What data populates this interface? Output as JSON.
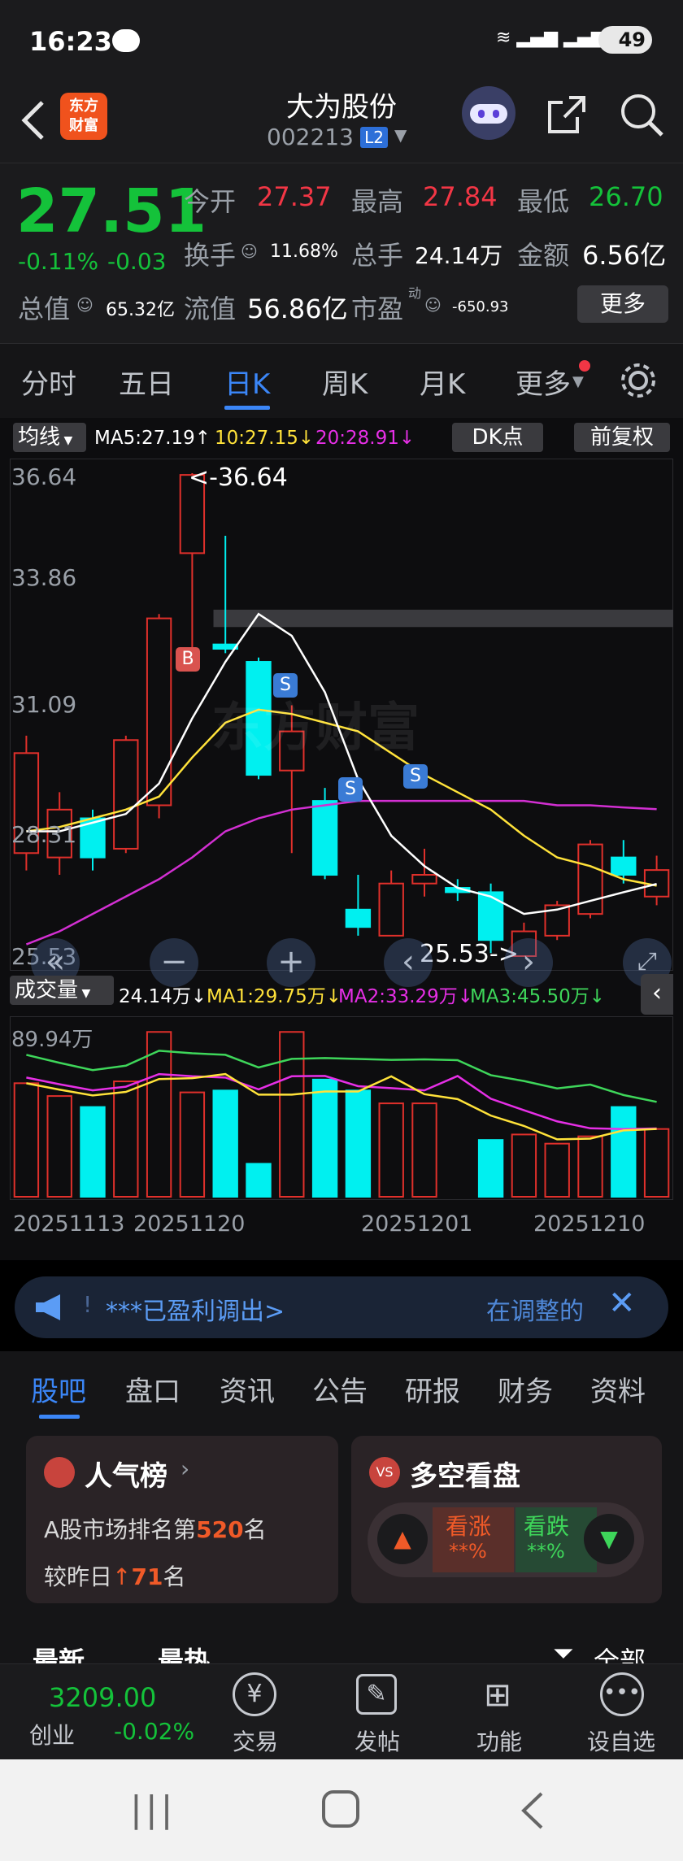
{
  "status": {
    "time": "16:23",
    "battery": "49"
  },
  "header": {
    "logo": "东方\n财富",
    "name": "大为股份",
    "code": "002213",
    "level": "L2"
  },
  "quote": {
    "price": "27.51",
    "change_pct": "-0.11%",
    "change": "-0.03",
    "open_label": "今开",
    "open": "27.37",
    "high_label": "最高",
    "high": "27.84",
    "low_label": "最低",
    "low": "26.70",
    "turnover_label": "换手",
    "turnover": "11.68%",
    "volume_label": "总手",
    "volume": "24.14万",
    "amount_label": "金额",
    "amount": "6.56亿",
    "mcap_label": "总值",
    "mcap": "65.32亿",
    "float_label": "流值",
    "float": "56.86亿",
    "pe_label": "市盈",
    "pe_sup": "动",
    "pe": "-650.93",
    "more": "更多"
  },
  "tabs": [
    "分时",
    "五日",
    "日K",
    "周K",
    "月K",
    "更多"
  ],
  "chart": {
    "ma_toggle": "均线",
    "ma5": "MA5:27.19↑",
    "ma10": "10:27.15↓",
    "ma20": "20:28.91↓",
    "dk": "DK点",
    "adjust": "前复权",
    "yticks": [
      "36.64",
      "33.86",
      "31.09",
      "28.31",
      "25.53"
    ],
    "high_mark": "<-36.64",
    "low_mark": "25.53->",
    "b_mark": "B",
    "s_mark": "S",
    "watermark": "东方财富",
    "vol_toggle": "成交量",
    "vol": "24.14万↓",
    "vma1": "MA1:29.75万↓",
    "vma2": "MA2:33.29万↓",
    "vma3": "MA3:45.50万↓",
    "vol_max": "89.94万",
    "dates": [
      "20251113",
      "20251120",
      "20251201",
      "20251210"
    ]
  },
  "chart_data": {
    "type": "candlestick",
    "candles": [
      {
        "o": 27.9,
        "c": 30.2,
        "h": 30.6,
        "l": 27.5
      },
      {
        "o": 27.8,
        "c": 28.9,
        "h": 29.3,
        "l": 27.4
      },
      {
        "o": 28.7,
        "c": 27.8,
        "h": 28.9,
        "l": 27.5
      },
      {
        "o": 28.0,
        "c": 30.5,
        "h": 30.6,
        "l": 27.9
      },
      {
        "o": 29.0,
        "c": 33.3,
        "h": 33.4,
        "l": 28.7
      },
      {
        "o": 34.8,
        "c": 36.6,
        "h": 36.64,
        "l": 32.6
      },
      {
        "o": 32.7,
        "c": 32.6,
        "h": 35.2,
        "l": 32.5
      },
      {
        "o": 32.3,
        "c": 29.7,
        "h": 32.4,
        "l": 29.6
      },
      {
        "o": 29.8,
        "c": 30.7,
        "h": 31.3,
        "l": 27.9
      },
      {
        "o": 29.1,
        "c": 27.4,
        "h": 29.4,
        "l": 27.3
      },
      {
        "o": 26.6,
        "c": 26.2,
        "h": 27.4,
        "l": 26.0
      },
      {
        "o": 26.0,
        "c": 27.2,
        "h": 27.5,
        "l": 26.0
      },
      {
        "o": 27.2,
        "c": 27.4,
        "h": 28.0,
        "l": 26.9
      },
      {
        "o": 27.1,
        "c": 27.0,
        "h": 27.3,
        "l": 26.8
      },
      {
        "o": 27.0,
        "c": 25.9,
        "h": 27.2,
        "l": 25.6
      },
      {
        "o": 25.53,
        "c": 26.1,
        "h": 26.3,
        "l": 25.53
      },
      {
        "o": 26.0,
        "c": 26.7,
        "h": 26.8,
        "l": 25.9
      },
      {
        "o": 26.5,
        "c": 28.1,
        "h": 28.2,
        "l": 26.4
      },
      {
        "o": 27.8,
        "c": 27.4,
        "h": 28.2,
        "l": 27.2
      },
      {
        "o": 26.9,
        "c": 27.51,
        "h": 27.84,
        "l": 26.7
      }
    ],
    "ma5": [
      28.4,
      28.4,
      28.6,
      28.8,
      29.5,
      31.0,
      32.3,
      33.4,
      32.9,
      31.6,
      29.6,
      28.3,
      27.6,
      27.1,
      26.9,
      26.5,
      26.6,
      26.8,
      27.0,
      27.19
    ],
    "ma10": [
      28.4,
      28.5,
      28.7,
      28.9,
      29.2,
      30.1,
      30.9,
      31.2,
      31.1,
      30.9,
      30.7,
      30.2,
      29.7,
      29.3,
      28.9,
      28.3,
      27.8,
      27.6,
      27.3,
      27.15
    ],
    "ma20": [
      25.8,
      26.1,
      26.5,
      26.9,
      27.3,
      27.8,
      28.4,
      28.7,
      28.9,
      29.0,
      29.1,
      29.1,
      29.1,
      29.1,
      29.1,
      29.1,
      29.0,
      29.0,
      28.95,
      28.91
    ],
    "volume": [
      62,
      55,
      49,
      63,
      90,
      57,
      58,
      18,
      90,
      64,
      58,
      51,
      51,
      0,
      31,
      34,
      29,
      33,
      49,
      37
    ],
    "ylim": [
      25.53,
      36.64
    ]
  },
  "banner": {
    "text": "***已盈利调出>",
    "right": "在调整的"
  },
  "news_tabs": [
    "股吧",
    "盘口",
    "资讯",
    "公告",
    "研报",
    "财务",
    "资料"
  ],
  "cards": {
    "hot_title": "人气榜",
    "hot_line1a": "A股市场排名第",
    "hot_rank": "520",
    "hot_line1b": "名",
    "hot_line2a": "较昨日",
    "hot_change": "71",
    "hot_line2b": "名",
    "ls_title": "多空看盘",
    "up": "看涨",
    "down": "看跌",
    "up_v": "**%",
    "down_v": "**%"
  },
  "sub_tabs": {
    "latest": "最新",
    "hot": "最热",
    "all": "全部"
  },
  "bottom": {
    "index": "3209.00",
    "index_name": "创业",
    "index_chg": "-0.02%",
    "trade": "交易",
    "post": "发帖",
    "func": "功能",
    "fav": "设自选"
  }
}
